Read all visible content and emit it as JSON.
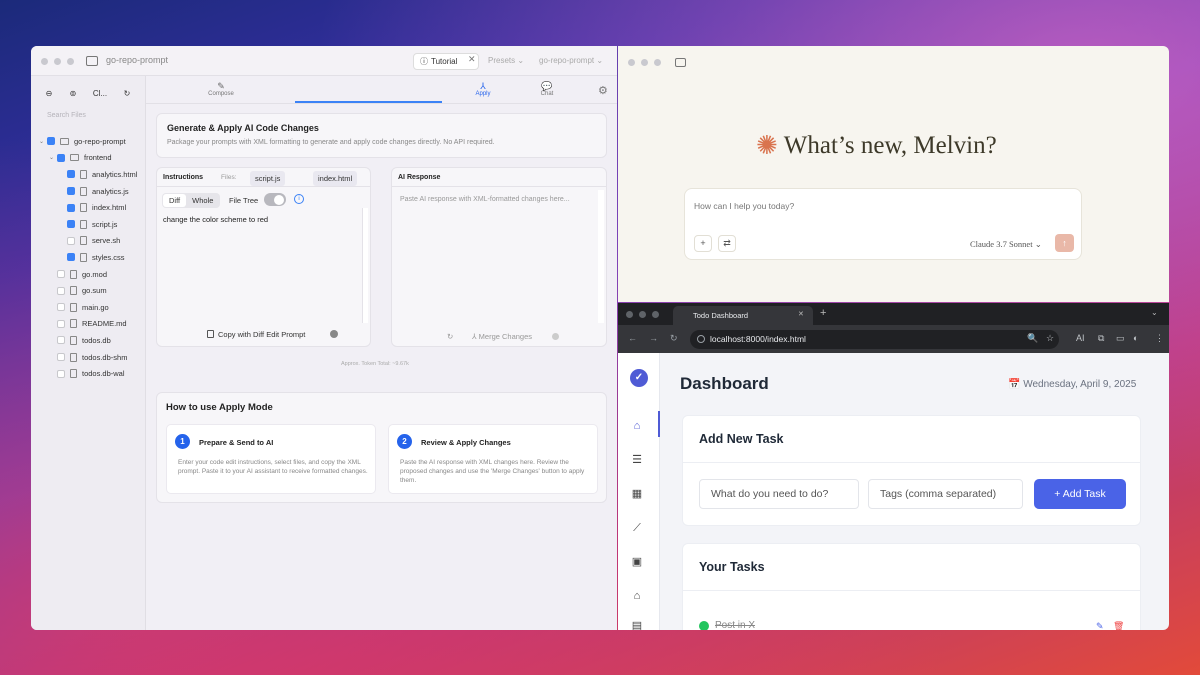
{
  "left_window": {
    "title": "go-repo-prompt",
    "tutorial_label": "Tutorial",
    "close_glyph": "✕",
    "presets_label": "Presets ⌄",
    "repo_label": "go-repo-prompt ⌄",
    "sidebar": {
      "buttons": [
        "⊖",
        "⊚",
        "Cl...",
        "↻"
      ],
      "search_placeholder": "Search Files",
      "tree": [
        {
          "name": "go-repo-prompt",
          "checked": true,
          "type": "folder",
          "indent": 0,
          "chevron": "⌄"
        },
        {
          "name": "frontend",
          "checked": true,
          "type": "folder",
          "indent": 1,
          "chevron": "⌄"
        },
        {
          "name": "analytics.html",
          "checked": true,
          "type": "file",
          "indent": 2
        },
        {
          "name": "analytics.js",
          "checked": true,
          "type": "file",
          "indent": 2
        },
        {
          "name": "index.html",
          "checked": true,
          "type": "file",
          "indent": 2
        },
        {
          "name": "script.js",
          "checked": true,
          "type": "file",
          "indent": 2
        },
        {
          "name": "serve.sh",
          "checked": false,
          "type": "file",
          "indent": 2
        },
        {
          "name": "styles.css",
          "checked": true,
          "type": "file",
          "indent": 2
        },
        {
          "name": "go.mod",
          "checked": false,
          "type": "file",
          "indent": 1
        },
        {
          "name": "go.sum",
          "checked": false,
          "type": "file",
          "indent": 1
        },
        {
          "name": "main.go",
          "checked": false,
          "type": "file",
          "indent": 1
        },
        {
          "name": "README.md",
          "checked": false,
          "type": "file",
          "indent": 1
        },
        {
          "name": "todos.db",
          "checked": false,
          "type": "file",
          "indent": 1
        },
        {
          "name": "todos.db-shm",
          "checked": false,
          "type": "file",
          "indent": 1
        },
        {
          "name": "todos.db-wal",
          "checked": false,
          "type": "file",
          "indent": 1
        }
      ]
    },
    "tabs": [
      {
        "label": "Compose",
        "icon": "✎"
      },
      {
        "label": "Apply",
        "icon": "⅄"
      },
      {
        "label": "Chat",
        "icon": "💬"
      }
    ],
    "active_tab": "Apply",
    "gear_glyph": "⚙",
    "generate": {
      "title": "Generate & Apply AI Code Changes",
      "description": "Package your prompts with XML formatting to generate and apply code changes directly. No API required."
    },
    "instructions": {
      "label": "Instructions",
      "files_label": "Files:",
      "files": [
        "script.js",
        "index.html"
      ],
      "segments": [
        "Diff",
        "Whole"
      ],
      "active_segment": "Diff",
      "file_tree_label": "File Tree",
      "info_glyph": "i",
      "text": "change the color scheme to red",
      "copy_button": "Copy with Diff Edit Prompt"
    },
    "response": {
      "label": "AI Response",
      "placeholder": "Paste AI response with XML-formatted changes here...",
      "refresh_glyph": "↻",
      "merge_button": "⅄  Merge Changes"
    },
    "token_total": "Approx. Token Total: ~9.67k",
    "howto": {
      "title": "How to use Apply Mode",
      "steps": [
        {
          "num": "1",
          "title": "Prepare & Send to AI",
          "desc": "Enter your code edit instructions, select files, and copy the XML prompt. Paste it to your AI assistant to receive formatted changes."
        },
        {
          "num": "2",
          "title": "Review & Apply Changes",
          "desc": "Paste the AI response with XML changes here. Review the proposed changes and use the 'Merge Changes' button to apply them."
        }
      ]
    }
  },
  "claude_window": {
    "spark_glyph": "✺",
    "greeting": "What’s new, Melvin?",
    "input_placeholder": "How can I help you today?",
    "add_glyph": "+",
    "tools_glyph": "⇄",
    "model": "Claude 3.7 Sonnet ⌄",
    "send_glyph": "↑"
  },
  "browser": {
    "tab_title": "Todo Dashboard",
    "tab_close_glyph": "✕",
    "new_tab_glyph": "+",
    "menu_glyph": "⌄",
    "nav_glyphs": [
      "←",
      "→",
      "↻"
    ],
    "url": "localhost:8000/index.html",
    "toolbar_glyphs": [
      "🔍",
      "☆",
      "AI",
      "⧉",
      "▭",
      "◐",
      "⋮"
    ],
    "app": {
      "logo_glyph": "✓",
      "nav_glyphs": [
        "⌂",
        "☰",
        "▦",
        "⟋",
        "▣",
        "⌂",
        "▤"
      ],
      "title": "Dashboard",
      "date": "📅 Wednesday, April 9, 2025",
      "add_task": {
        "title": "Add New Task",
        "task_placeholder": "What do you need to do?",
        "tags_placeholder": "Tags (comma separated)",
        "button": "+ Add Task"
      },
      "tasks": {
        "title": "Your Tasks",
        "items": [
          {
            "text": "Post in X",
            "done": true
          }
        ],
        "edit_glyph": "✎",
        "delete_glyph": "🗑"
      }
    }
  }
}
